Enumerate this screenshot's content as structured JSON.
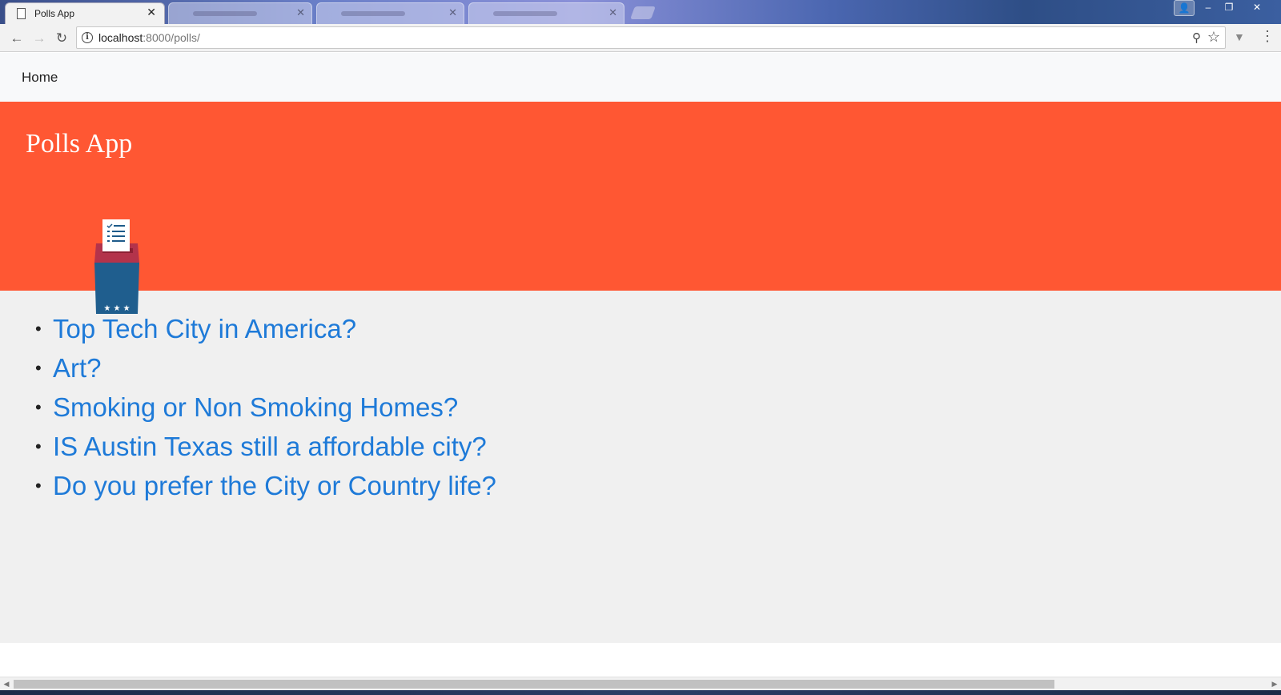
{
  "browser": {
    "tabs": [
      {
        "title": "Polls App",
        "active": true
      },
      {
        "title": "",
        "active": false
      },
      {
        "title": "",
        "active": false
      },
      {
        "title": "",
        "active": false
      }
    ],
    "close_glyph": "✕",
    "url_host": "localhost",
    "url_rest": ":8000/polls/",
    "info_glyph": "i",
    "back_glyph": "←",
    "forward_glyph": "→",
    "reload_glyph": "↻",
    "zoom_glyph": "⚲",
    "star_glyph": "☆",
    "menu_glyph": "⋮",
    "window_controls": {
      "minimize": "–",
      "maximize": "❐",
      "close": "✕"
    }
  },
  "navbar": {
    "home_label": "Home"
  },
  "hero": {
    "title": "Polls App",
    "background": "#ff5733",
    "icon": "ballot-box-icon"
  },
  "polls": [
    {
      "text": "Top Tech City in America?"
    },
    {
      "text": "Art?"
    },
    {
      "text": "Smoking or Non Smoking Homes?"
    },
    {
      "text": "IS Austin Texas still a affordable city?"
    },
    {
      "text": "Do you prefer the City or Country life?"
    }
  ],
  "colors": {
    "link": "#1e7ad8",
    "page_bg": "#f0f0f0",
    "navbar_bg": "#f8f9fa"
  }
}
